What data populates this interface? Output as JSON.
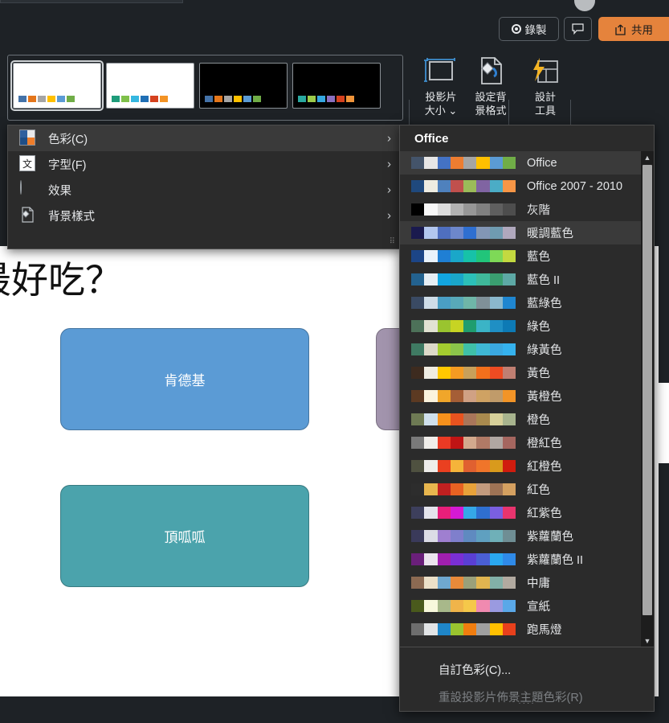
{
  "topbar": {
    "record_label": "錄製",
    "record_icon": "record-circle-icon",
    "comment_icon": "comment-bubble-icon",
    "share_label": "共用",
    "share_icon": "share-arrow-icon",
    "share_color": "#e5833c"
  },
  "ribbon": {
    "variants": [
      {
        "name": "variant-1",
        "bg": "#ffffff",
        "swatches": [
          "#4472a8",
          "#e4761b",
          "#a5a5a5",
          "#ffc000",
          "#5b9bd5",
          "#70ad47"
        ],
        "selected": true
      },
      {
        "name": "variant-2",
        "bg": "#ffffff",
        "swatches": [
          "#1e9c7a",
          "#7fc04a",
          "#35b7e0",
          "#1f6fb5",
          "#d5411e",
          "#f39325"
        ],
        "selected": false
      },
      {
        "name": "variant-3",
        "bg": "#000000",
        "swatches": [
          "#4472a8",
          "#e4761b",
          "#a5a5a5",
          "#ffc000",
          "#5b9bd5",
          "#70ad47"
        ],
        "selected": false
      },
      {
        "name": "variant-4",
        "bg": "#000000",
        "swatches": [
          "#2aa9a0",
          "#9ccb4a",
          "#35a7e0",
          "#8a6fc0",
          "#d5411e",
          "#f0943a"
        ],
        "selected": false
      }
    ],
    "buttons": [
      {
        "name": "slide-size-button",
        "label": "投影片\n大小 ⌄",
        "icon": "slide-size-icon"
      },
      {
        "name": "format-background-button",
        "label": "設定背\n景格式",
        "icon": "format-background-icon"
      },
      {
        "name": "designer-button",
        "label": "設計\n工具",
        "icon": "designer-lightning-icon"
      }
    ]
  },
  "menu": {
    "items": [
      {
        "label": "色彩(C)",
        "icon": "colors-icon",
        "highlighted": true,
        "has_submenu": true
      },
      {
        "label": "字型(F)",
        "icon": "font-icon",
        "highlighted": false,
        "has_submenu": true
      },
      {
        "label": "效果",
        "icon": "effects-icon",
        "highlighted": false,
        "has_submenu": true
      },
      {
        "label": "背景樣式",
        "icon": "background-styles-icon",
        "highlighted": false,
        "has_submenu": true
      }
    ],
    "grip": "⠿"
  },
  "submenu": {
    "header": "Office",
    "themes": [
      {
        "name": "Office",
        "highlighted": true,
        "palette": [
          "#44546a",
          "#e7e6e6",
          "#4472c4",
          "#ed7d31",
          "#a5a5a5",
          "#ffc000",
          "#5b9bd5",
          "#70ad47"
        ]
      },
      {
        "name": "Office 2007 - 2010",
        "highlighted": false,
        "palette": [
          "#1f497d",
          "#eeece1",
          "#4f81bd",
          "#c0504d",
          "#9bbb59",
          "#8064a2",
          "#4bacc6",
          "#f79646"
        ]
      },
      {
        "name": "灰階",
        "highlighted": false,
        "palette": [
          "#000000",
          "#f8f8f8",
          "#dddddd",
          "#b2b2b2",
          "#969696",
          "#808080",
          "#5f5f5f",
          "#4d4d4d"
        ]
      },
      {
        "name": "暖調藍色",
        "highlighted": true,
        "palette": [
          "#1a1a4e",
          "#b3c7ee",
          "#4f6fbf",
          "#6d87cb",
          "#2f6fd0",
          "#8296b5",
          "#6f9bb0",
          "#b0a8bd"
        ]
      },
      {
        "name": "藍色",
        "highlighted": false,
        "palette": [
          "#1c4587",
          "#e9f2fb",
          "#1f7fd4",
          "#1aa7c9",
          "#17c2a8",
          "#21c57a",
          "#7ed957",
          "#c3d940"
        ]
      },
      {
        "name": "藍色 II",
        "highlighted": false,
        "palette": [
          "#23628f",
          "#e6eef4",
          "#12a5e0",
          "#1aa6c9",
          "#2cc0b8",
          "#3fb89a",
          "#3a9e70",
          "#5da9a5"
        ]
      },
      {
        "name": "藍綠色",
        "highlighted": false,
        "palette": [
          "#3a4a63",
          "#cfdde8",
          "#4a9ec4",
          "#58a9b8",
          "#6fb6a8",
          "#7f9098",
          "#8bb8cd",
          "#1f86d0"
        ]
      },
      {
        "name": "綠色",
        "highlighted": false,
        "palette": [
          "#4d7159",
          "#e2e2d2",
          "#9ac42f",
          "#c7d423",
          "#1f9d6e",
          "#3bb4c6",
          "#1f8fc4",
          "#0d7ab5"
        ]
      },
      {
        "name": "綠黃色",
        "highlighted": false,
        "palette": [
          "#3f7a63",
          "#ddd9c9",
          "#a4cc2f",
          "#8bc44a",
          "#3fc0a8",
          "#3fb8d4",
          "#3aa8e0",
          "#35b2ee"
        ]
      },
      {
        "name": "黃色",
        "highlighted": false,
        "palette": [
          "#3d2b1f",
          "#f0ece2",
          "#ffc800",
          "#f59b22",
          "#c8a05a",
          "#f2701c",
          "#ee4b22",
          "#c07f72"
        ]
      },
      {
        "name": "黃橙色",
        "highlighted": false,
        "palette": [
          "#5c3a22",
          "#fbf3dc",
          "#f0a62a",
          "#a55e36",
          "#d0a184",
          "#cfa263",
          "#c09b6a",
          "#f29427"
        ]
      },
      {
        "name": "橙色",
        "highlighted": false,
        "palette": [
          "#6e7a54",
          "#cfe0ec",
          "#f6911c",
          "#e8531f",
          "#a9765a",
          "#a98a4e",
          "#d7d09a",
          "#a8b48e"
        ]
      },
      {
        "name": "橙紅色",
        "highlighted": false,
        "palette": [
          "#7a7a7a",
          "#f0eeea",
          "#ea3a24",
          "#c01414",
          "#d3a98d",
          "#b07a66",
          "#b0a7a2",
          "#a5665f"
        ]
      },
      {
        "name": "紅橙色",
        "highlighted": false,
        "palette": [
          "#4f5140",
          "#efeeea",
          "#ea4020",
          "#f5b43a",
          "#e06030",
          "#f0752a",
          "#d99a1c",
          "#d01c0e"
        ]
      },
      {
        "name": "紅色",
        "highlighted": false,
        "palette": [
          "#2d2d2d",
          "#e8b64e",
          "#c02020",
          "#e86222",
          "#e8a23a",
          "#c39b7e",
          "#9e7355",
          "#d4a060"
        ]
      },
      {
        "name": "紅紫色",
        "highlighted": false,
        "palette": [
          "#3d3f5c",
          "#e4e4ec",
          "#e81f7a",
          "#d41ad4",
          "#35a8e8",
          "#2f6fd0",
          "#7a5fe0",
          "#e8346e"
        ]
      },
      {
        "name": "紫蘿蘭色",
        "highlighted": false,
        "palette": [
          "#3a3a5a",
          "#dcdce6",
          "#9f7fd0",
          "#7f7fcc",
          "#5f8ac0",
          "#5fa0c0",
          "#6fb0b8",
          "#6f8e94"
        ]
      },
      {
        "name": "紫蘿蘭色 II",
        "highlighted": false,
        "palette": [
          "#6a1f7a",
          "#ece4ee",
          "#a01fae",
          "#7a2fd4",
          "#5a3fd4",
          "#4a5fd4",
          "#2aa8f0",
          "#2f8ae8"
        ]
      },
      {
        "name": "中庸",
        "highlighted": false,
        "palette": [
          "#8c6a52",
          "#ece0c8",
          "#6fa8d0",
          "#e88a3a",
          "#9aa07a",
          "#e0b450",
          "#82b0a8",
          "#b2aaa0"
        ]
      },
      {
        "name": "宣紙",
        "highlighted": false,
        "palette": [
          "#4a5a1c",
          "#f8f8dc",
          "#a8b88a",
          "#f0b44a",
          "#f5c84a",
          "#f08ab0",
          "#9a9ae0",
          "#5aa8e8"
        ]
      },
      {
        "name": "跑馬燈",
        "highlighted": false,
        "palette": [
          "#6e6e6e",
          "#e2e4e6",
          "#1f86c8",
          "#9ac42f",
          "#f07d0f",
          "#a0a0a0",
          "#ffc000",
          "#e8401c"
        ]
      }
    ],
    "footer": [
      {
        "label": "自訂色彩(C)...",
        "disabled": false
      },
      {
        "label": "重設投影片佈景主題色彩(R)",
        "disabled": true
      }
    ],
    "grip": "····",
    "scroll_up_icon": "scroll-up-arrow-icon",
    "scroll_down_icon": "scroll-down-arrow-icon"
  },
  "slide": {
    "title": "條最好吃？",
    "shapes": [
      {
        "name": "shape-kfc",
        "text": "肯德基",
        "fill": "#5b9bd5"
      },
      {
        "name": "shape-dgg",
        "text": "頂呱呱",
        "fill": "#4ba3ac"
      },
      {
        "name": "shape-third",
        "text": "",
        "fill": "#a294ad"
      }
    ]
  }
}
